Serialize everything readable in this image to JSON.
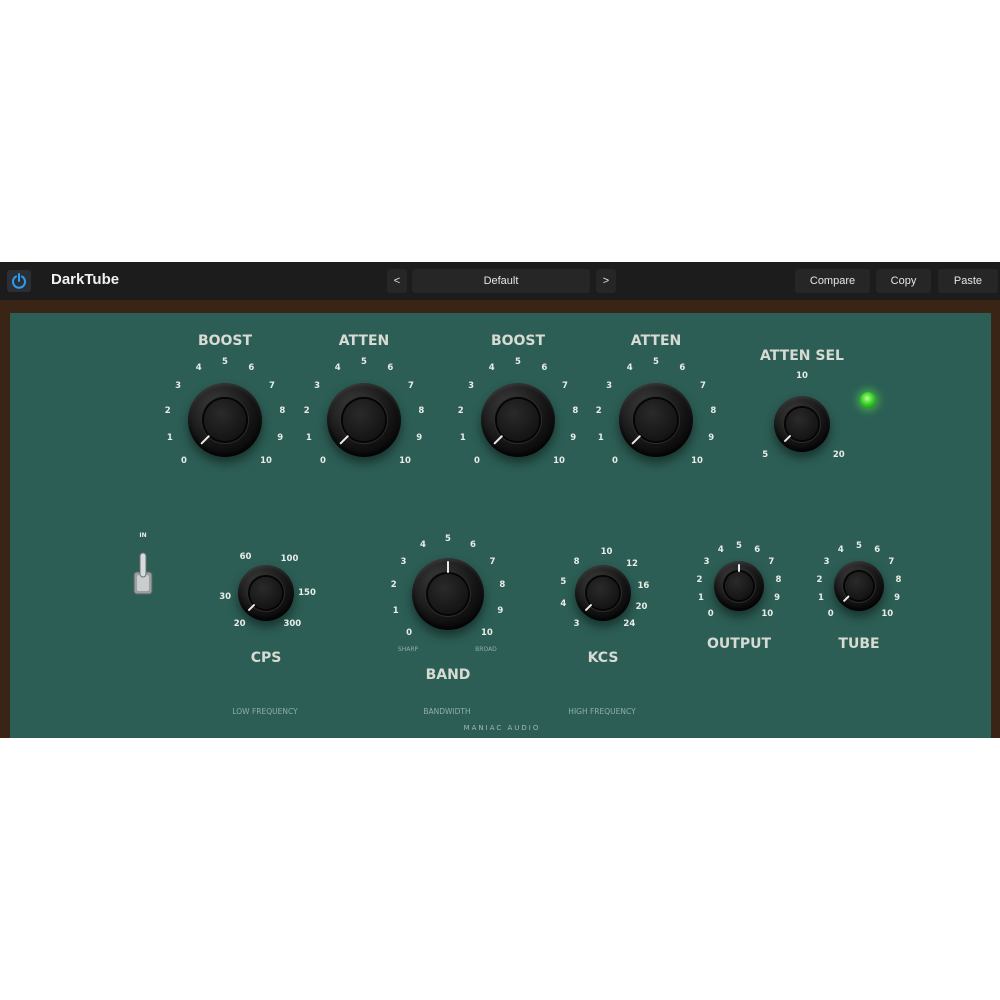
{
  "header": {
    "app_title": "DarkTube",
    "preset_prev": "<",
    "preset_name": "Default",
    "preset_next": ">",
    "compare": "Compare",
    "copy": "Copy",
    "paste": "Paste",
    "power_icon": "power-icon"
  },
  "panel": {
    "brand": "MANIAC AUDIO",
    "switch_label": "IN",
    "sections": {
      "low_freq": "LOW FREQUENCY",
      "bandwidth": "BANDWIDTH",
      "high_freq": "HIGH FREQUENCY"
    },
    "band_sharp": "SHARP",
    "band_broad": "BROAD",
    "led_color": "#36d12a",
    "panel_color": "#2c5e55"
  },
  "knobs": [
    {
      "name": "low-boost-knob",
      "label": "BOOST",
      "ticks": [
        "0",
        "1",
        "2",
        "3",
        "4",
        "5",
        "6",
        "7",
        "8",
        "9",
        "10"
      ]
    },
    {
      "name": "low-atten-knob",
      "label": "ATTEN",
      "ticks": [
        "0",
        "1",
        "2",
        "3",
        "4",
        "5",
        "6",
        "7",
        "8",
        "9",
        "10"
      ]
    },
    {
      "name": "high-boost-knob",
      "label": "BOOST",
      "ticks": [
        "0",
        "1",
        "2",
        "3",
        "4",
        "5",
        "6",
        "7",
        "8",
        "9",
        "10"
      ]
    },
    {
      "name": "high-atten-knob",
      "label": "ATTEN",
      "ticks": [
        "0",
        "1",
        "2",
        "3",
        "4",
        "5",
        "6",
        "7",
        "8",
        "9",
        "10"
      ]
    },
    {
      "name": "atten-sel-knob",
      "label": "ATTEN SEL",
      "ticks": [
        "5",
        "10",
        "20"
      ]
    },
    {
      "name": "cps-knob",
      "label": "CPS",
      "ticks": [
        "20",
        "30",
        "60",
        "100",
        "150",
        "300"
      ]
    },
    {
      "name": "band-knob",
      "label": "BAND",
      "ticks": [
        "0",
        "1",
        "2",
        "3",
        "4",
        "5",
        "6",
        "7",
        "8",
        "9",
        "10"
      ]
    },
    {
      "name": "kcs-knob",
      "label": "KCS",
      "ticks": [
        "3",
        "4",
        "5",
        "8",
        "10",
        "12",
        "16",
        "20",
        "24"
      ]
    },
    {
      "name": "output-knob",
      "label": "OUTPUT",
      "ticks": [
        "0",
        "1",
        "2",
        "3",
        "4",
        "5",
        "6",
        "7",
        "8",
        "9",
        "10"
      ]
    },
    {
      "name": "tube-knob",
      "label": "TUBE",
      "ticks": [
        "0",
        "1",
        "2",
        "3",
        "4",
        "5",
        "6",
        "7",
        "8",
        "9",
        "10"
      ]
    }
  ]
}
